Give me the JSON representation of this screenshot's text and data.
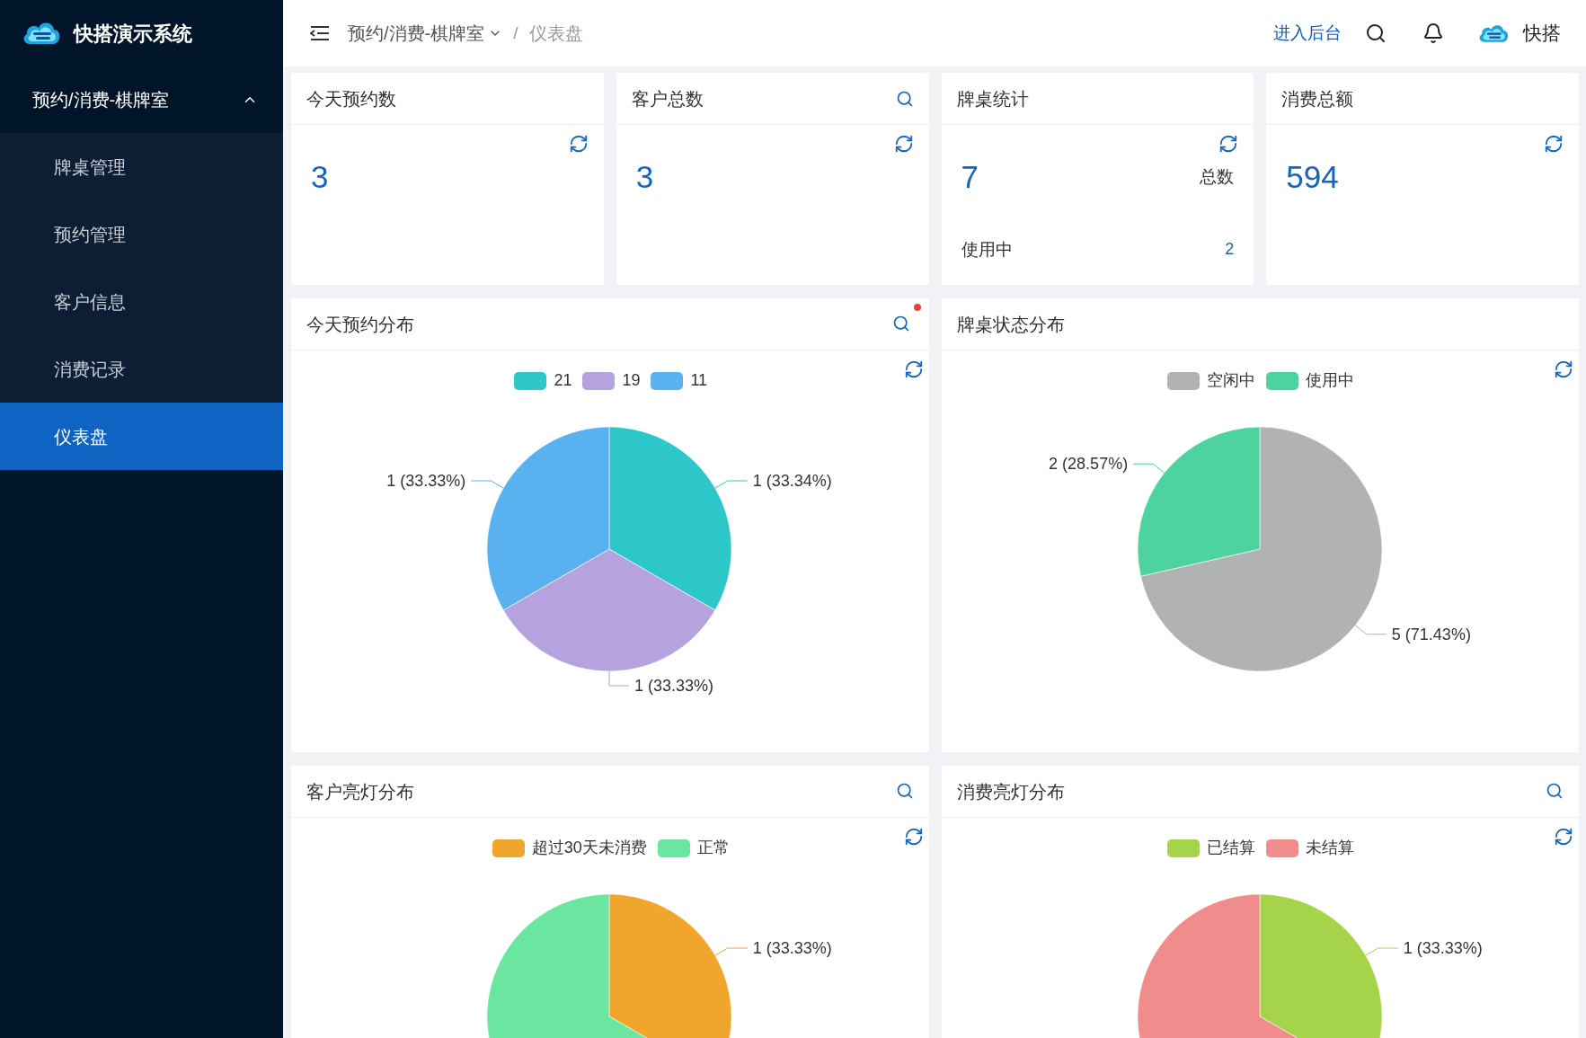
{
  "sidebar": {
    "brand": "快搭演示系统",
    "menu": {
      "label": "预约/消费-棋牌室",
      "expanded": true,
      "items": [
        {
          "label": "牌桌管理",
          "selected": false
        },
        {
          "label": "预约管理",
          "selected": false
        },
        {
          "label": "客户信息",
          "selected": false
        },
        {
          "label": "消费记录",
          "selected": false
        },
        {
          "label": "仪表盘",
          "selected": true
        }
      ]
    }
  },
  "header": {
    "breadcrumb": [
      {
        "label": "预约/消费-棋牌室",
        "dropdown": true
      },
      {
        "label": "仪表盘",
        "dropdown": false
      }
    ],
    "separator": "/",
    "admin_link": "进入后台",
    "user": "快搭"
  },
  "stats": [
    {
      "title": "今天预约数",
      "search": false,
      "value": "3"
    },
    {
      "title": "客户总数",
      "search": true,
      "value": "3"
    },
    {
      "title": "牌桌统计",
      "search": false,
      "value": "7",
      "value_caption": "总数",
      "sub_label": "使用中",
      "sub_value": "2"
    },
    {
      "title": "消费总额",
      "search": false,
      "value": "594"
    }
  ],
  "charts": [
    {
      "search": true,
      "alert_dot": true,
      "chart_data": {
        "type": "pie",
        "title": "今天预约分布",
        "categories": [
          "21",
          "19",
          "11"
        ],
        "values": [
          1,
          1,
          1
        ],
        "colors": [
          "#2ec7c9",
          "#b6a2de",
          "#5ab1ef"
        ],
        "value_labels": [
          "1 (33.34%)",
          "1 (33.33%)",
          "1 (33.33%)"
        ]
      }
    },
    {
      "search": false,
      "alert_dot": false,
      "chart_data": {
        "type": "pie",
        "title": "牌桌状态分布",
        "categories": [
          "空闲中",
          "使用中"
        ],
        "values": [
          5,
          2
        ],
        "colors": [
          "#b1b2b3",
          "#4cd3a0"
        ],
        "value_labels": [
          "5 (71.43%)",
          "2 (28.57%)"
        ]
      }
    },
    {
      "search": true,
      "alert_dot": false,
      "chart_data": {
        "type": "pie",
        "title": "客户亮灯分布",
        "categories": [
          "超过30天未消费",
          "正常"
        ],
        "values": [
          1,
          2
        ],
        "colors": [
          "#f0a62c",
          "#6be6a0"
        ],
        "value_labels": [
          "1 (33.33%)",
          null
        ]
      }
    },
    {
      "search": true,
      "alert_dot": false,
      "chart_data": {
        "type": "pie",
        "title": "消费亮灯分布",
        "categories": [
          "已结算",
          "未结算"
        ],
        "values": [
          1,
          2
        ],
        "colors": [
          "#a5d44a",
          "#f08c8b"
        ],
        "value_labels": [
          "1 (33.33%)",
          null
        ]
      }
    }
  ]
}
